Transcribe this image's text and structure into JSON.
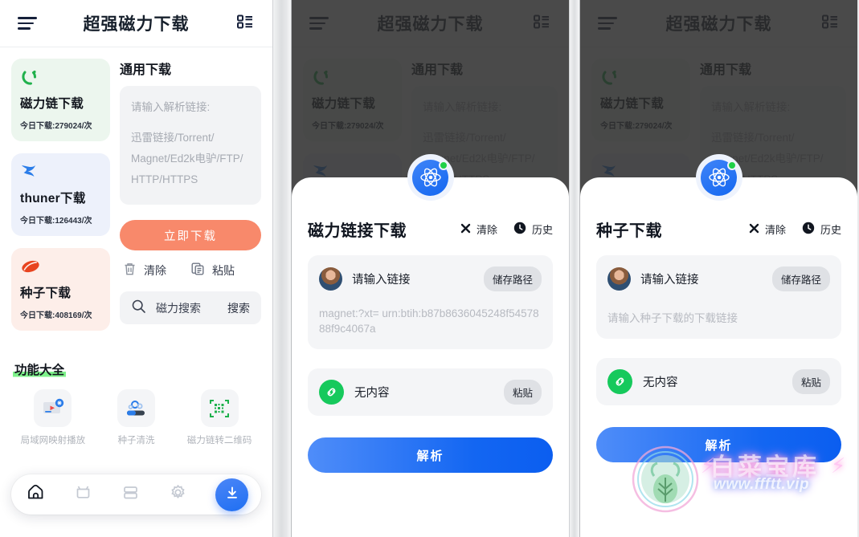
{
  "header": {
    "title": "超强磁力下载",
    "menu_icon": "hamburger-menu-icon",
    "listview_icon": "list-view-icon"
  },
  "home": {
    "sources": [
      {
        "name": "磁力链下载",
        "stat": "今日下载:279024/次",
        "icon": "magnet-icon",
        "color": "#21b14c",
        "bg": "#ecf6ee"
      },
      {
        "name": "thuner下载",
        "stat": "今日下载:126443/次",
        "icon": "thunder-bird-icon",
        "color": "#2b7de9",
        "bg": "#edf1fb"
      },
      {
        "name": "种子下载",
        "stat": "今日下载:408169/次",
        "icon": "torrent-seed-icon",
        "color": "#e8441f",
        "bg": "#fdeee9"
      }
    ],
    "general": {
      "section_title": "通用下载",
      "input_hint": "请输入解析链接:",
      "input_types_line1": "迅雷链接/Torrent/",
      "input_types_line2": "Magnet/Ed2k电驴/FTP/",
      "input_types_line3": "HTTP/HTTPS",
      "download_button": "立即下载",
      "clear_label": "清除",
      "clear_icon": "trash-icon",
      "paste_label": "粘贴",
      "paste_icon": "clipboard-icon",
      "search_placeholder": "磁力搜索",
      "search_icon": "search-icon",
      "search_button": "搜索"
    },
    "functions": {
      "title": "功能大全",
      "items": [
        {
          "label": "局域网映射播放",
          "icon": "lan-cast-icon"
        },
        {
          "label": "种子清洗",
          "icon": "torrent-clean-icon"
        },
        {
          "label": "磁力链转二维码",
          "icon": "magnet-qrcode-icon"
        }
      ]
    },
    "tabbar": {
      "items": [
        {
          "name": "home",
          "icon": "home-icon",
          "active": true
        },
        {
          "name": "media",
          "icon": "tv-icon",
          "active": false
        },
        {
          "name": "storage",
          "icon": "storage-box-icon",
          "active": false
        },
        {
          "name": "settings",
          "icon": "gear-icon",
          "active": false
        }
      ],
      "fab_icon": "download-icon",
      "fab_color": "#1f6ff2"
    }
  },
  "sheet_magnet": {
    "title": "磁力链接下载",
    "clear_label": "清除",
    "clear_icon": "close-x-icon",
    "history_label": "历史",
    "history_icon": "clock-icon",
    "input_placeholder": "请输入链接",
    "save_path_label": "储存路径",
    "body_text": "magnet:?xt= urn:btih:b87b8636045248f5457888f9c4067a",
    "clipboard_status": "无内容",
    "clipboard_icon": "link-icon",
    "paste_label": "粘贴",
    "parse_button": "解析",
    "badge_icon": "atom-icon"
  },
  "sheet_torrent": {
    "title": "种子下载",
    "clear_label": "清除",
    "clear_icon": "close-x-icon",
    "history_label": "历史",
    "history_icon": "clock-icon",
    "input_placeholder": "请输入链接",
    "save_path_label": "储存路径",
    "body_text": "请输入种子下载的下载链接",
    "clipboard_status": "无内容",
    "clipboard_icon": "link-icon",
    "paste_label": "粘贴",
    "parse_button": "解析",
    "badge_icon": "atom-icon"
  },
  "watermark": {
    "name": "白菜宝库",
    "url": "www.ffftt.vip",
    "logo_icon": "cabbage-logo-icon"
  }
}
